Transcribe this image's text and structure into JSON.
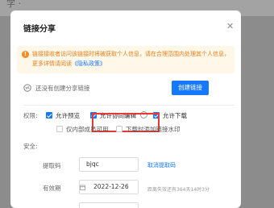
{
  "background": {
    "text": "字 ·"
  },
  "dialog": {
    "title": "链接分享",
    "close_glyph": "✕",
    "notice": {
      "icon_glyph": "!",
      "text": "链接接收者访问该链接时将被获取个人信息，请在合理范围内处理其个人信息，更多详情请阅读",
      "link": "《隐私政策》"
    },
    "link_status": "还没有创建分享链接",
    "create_button": "创建链接",
    "permissions": {
      "label": "权限:",
      "options": [
        {
          "label": "允许预览",
          "checked": true
        },
        {
          "label": "允许协同编辑",
          "checked": true
        },
        {
          "label": "允许下载",
          "checked": true
        },
        {
          "label": "仅内部成员可用",
          "checked": false
        },
        {
          "label": "下载时添加链接水印",
          "checked": false
        }
      ],
      "info_glyph": "i"
    },
    "security": {
      "label": "安全:",
      "code_label": "提取码",
      "code_value": "bjqc",
      "cancel_code": "取消提取码",
      "expiry_label": "有效期",
      "expiry_value": "2022-12-26",
      "expiry_hint": "距离失效还有364天14时3分"
    }
  },
  "colors": {
    "accent": "#1677ff",
    "warning": "#ff8a1f",
    "highlight": "#e53935"
  }
}
